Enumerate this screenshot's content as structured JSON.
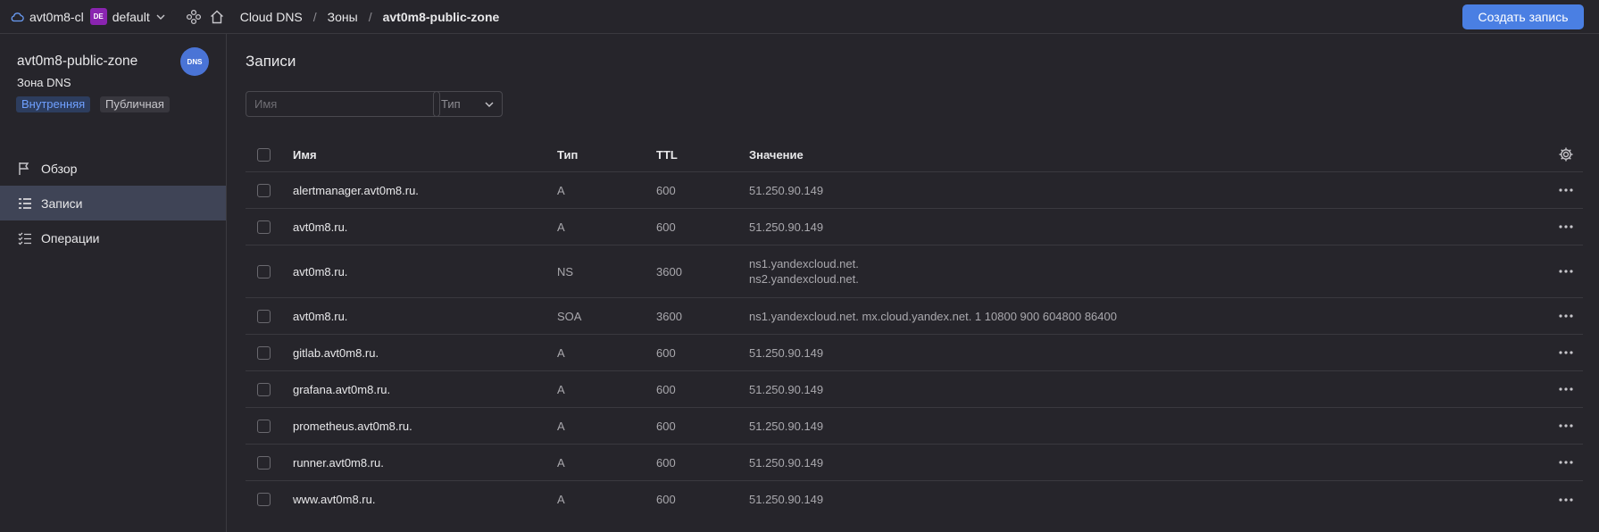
{
  "topbar": {
    "cloud_name": "avt0m8-cl",
    "folder_badge": "DE",
    "folder_name": "default",
    "breadcrumbs": [
      "Cloud DNS",
      "Зоны",
      "avt0m8-public-zone"
    ],
    "separator": "/",
    "create_button": "Создать запись",
    "accent_color": "#4a7fe3"
  },
  "sidebar": {
    "zone_title": "avt0m8-public-zone",
    "zone_subtitle": "Зона DNS",
    "avatar_text": "DNS",
    "tags": [
      "Внутренняя",
      "Публичная"
    ],
    "nav": [
      {
        "label": "Обзор",
        "icon": "flag-icon",
        "active": false
      },
      {
        "label": "Записи",
        "icon": "list-icon",
        "active": true
      },
      {
        "label": "Операции",
        "icon": "checklist-icon",
        "active": false
      }
    ]
  },
  "main": {
    "title": "Записи",
    "filter_name_placeholder": "Имя",
    "filter_type_placeholder": "Тип",
    "columns": [
      "Имя",
      "Тип",
      "TTL",
      "Значение"
    ],
    "records": [
      {
        "name": "alertmanager.avt0m8.ru.",
        "type": "A",
        "ttl": "600",
        "value": [
          "51.250.90.149"
        ]
      },
      {
        "name": "avt0m8.ru.",
        "type": "A",
        "ttl": "600",
        "value": [
          "51.250.90.149"
        ]
      },
      {
        "name": "avt0m8.ru.",
        "type": "NS",
        "ttl": "3600",
        "value": [
          "ns1.yandexcloud.net.",
          "ns2.yandexcloud.net."
        ]
      },
      {
        "name": "avt0m8.ru.",
        "type": "SOA",
        "ttl": "3600",
        "value": [
          "ns1.yandexcloud.net. mx.cloud.yandex.net. 1 10800 900 604800 86400"
        ]
      },
      {
        "name": "gitlab.avt0m8.ru.",
        "type": "A",
        "ttl": "600",
        "value": [
          "51.250.90.149"
        ]
      },
      {
        "name": "grafana.avt0m8.ru.",
        "type": "A",
        "ttl": "600",
        "value": [
          "51.250.90.149"
        ]
      },
      {
        "name": "prometheus.avt0m8.ru.",
        "type": "A",
        "ttl": "600",
        "value": [
          "51.250.90.149"
        ]
      },
      {
        "name": "runner.avt0m8.ru.",
        "type": "A",
        "ttl": "600",
        "value": [
          "51.250.90.149"
        ]
      },
      {
        "name": "www.avt0m8.ru.",
        "type": "A",
        "ttl": "600",
        "value": [
          "51.250.90.149"
        ]
      }
    ]
  }
}
